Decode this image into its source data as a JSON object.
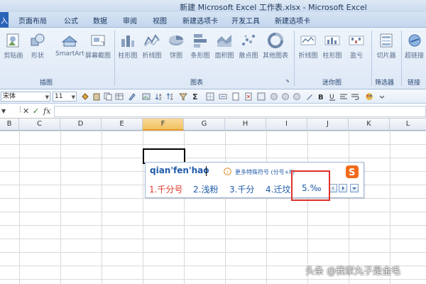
{
  "window": {
    "title": "新建 Microsoft Excel 工作表.xlsx - Microsoft Excel"
  },
  "ribbon_tabs": [
    {
      "label": "入"
    },
    {
      "label": "页面布局"
    },
    {
      "label": "公式"
    },
    {
      "label": "数据"
    },
    {
      "label": "审阅"
    },
    {
      "label": "视图"
    },
    {
      "label": "新建选项卡"
    },
    {
      "label": "开发工具"
    },
    {
      "label": "新建选项卡"
    }
  ],
  "ribbon": {
    "buttons": [
      {
        "label": "剪贴画",
        "icon": "clipart-icon"
      },
      {
        "label": "形状",
        "icon": "shapes-icon"
      },
      {
        "label": "SmartArt",
        "icon": "smartart-icon"
      },
      {
        "label": "屏幕截图",
        "icon": "screenshot-icon"
      },
      {
        "label": "柱形图",
        "icon": "column-chart-icon"
      },
      {
        "label": "折线图",
        "icon": "line-chart-icon"
      },
      {
        "label": "饼图",
        "icon": "pie-chart-icon"
      },
      {
        "label": "条形图",
        "icon": "bar-chart-icon"
      },
      {
        "label": "面积图",
        "icon": "area-chart-icon"
      },
      {
        "label": "散点图",
        "icon": "scatter-chart-icon"
      },
      {
        "label": "其他图表",
        "icon": "other-charts-icon"
      },
      {
        "label": "折线图",
        "icon": "sparkline-line-icon"
      },
      {
        "label": "柱形图",
        "icon": "sparkline-column-icon"
      },
      {
        "label": "盈亏",
        "icon": "sparkline-winloss-icon"
      },
      {
        "label": "切片器",
        "icon": "slicer-icon"
      },
      {
        "label": "超链接",
        "icon": "hyperlink-icon"
      }
    ],
    "groups": [
      {
        "label": "插图"
      },
      {
        "label": "图表"
      },
      {
        "label": "迷你图"
      },
      {
        "label": "筛选器"
      },
      {
        "label": "链接"
      }
    ]
  },
  "toolbar": {
    "font_name": "宋体",
    "font_size": "11"
  },
  "formula_bar": {
    "fx_label": "fx",
    "value": ""
  },
  "columns": [
    "B",
    "C",
    "D",
    "E",
    "F",
    "G",
    "H",
    "I",
    "J",
    "K",
    "L"
  ],
  "selected_column": "F",
  "ime": {
    "pinyin": "qian'fen'hao",
    "more_symbols": "更多特殊符号 (分号+F)",
    "candidates": [
      {
        "label": "1.千分号"
      },
      {
        "label": "2.浅粉"
      },
      {
        "label": "3.千分"
      },
      {
        "label": "4.迁坟"
      },
      {
        "label": "5.‰"
      }
    ]
  },
  "watermark": "头条 @我家丸子是金毛",
  "colors": {
    "ribbon_bg": "#dde8f6",
    "selected_header": "#f1c15f",
    "highlight": "#e0302a",
    "ime_text": "#1e5aa8"
  }
}
